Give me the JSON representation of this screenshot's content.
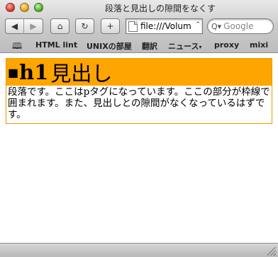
{
  "window": {
    "title": "段落と見出しの隙間をなくす"
  },
  "toolbar": {
    "back_glyph": "◀",
    "forward_glyph": "▶",
    "home_glyph": "⌂",
    "reload_glyph": "↻",
    "add_glyph": "+",
    "address": {
      "url": "file:///Volum",
      "arrow": "⌃"
    },
    "search": {
      "icon": "Q▾",
      "placeholder": "Google"
    }
  },
  "bookmarks": {
    "book_glyph": "🕮",
    "items": [
      {
        "label": "HTML lint"
      },
      {
        "label": "UNIXの部屋"
      },
      {
        "label": "翻訳"
      },
      {
        "label": "ニュース",
        "arrow": "▾"
      },
      {
        "label": "proxy"
      },
      {
        "label": "mixi"
      }
    ]
  },
  "page": {
    "heading": {
      "square": "■",
      "tag": "h1",
      "text": "見出し"
    },
    "paragraph": "段落です。ここはpタグになっています。ここの部分が枠線で囲まれます。また、見出しとの隙間がなくなっているはずです。"
  },
  "colors": {
    "heading_bg": "#ffa500",
    "box_border": "#e89a00"
  }
}
